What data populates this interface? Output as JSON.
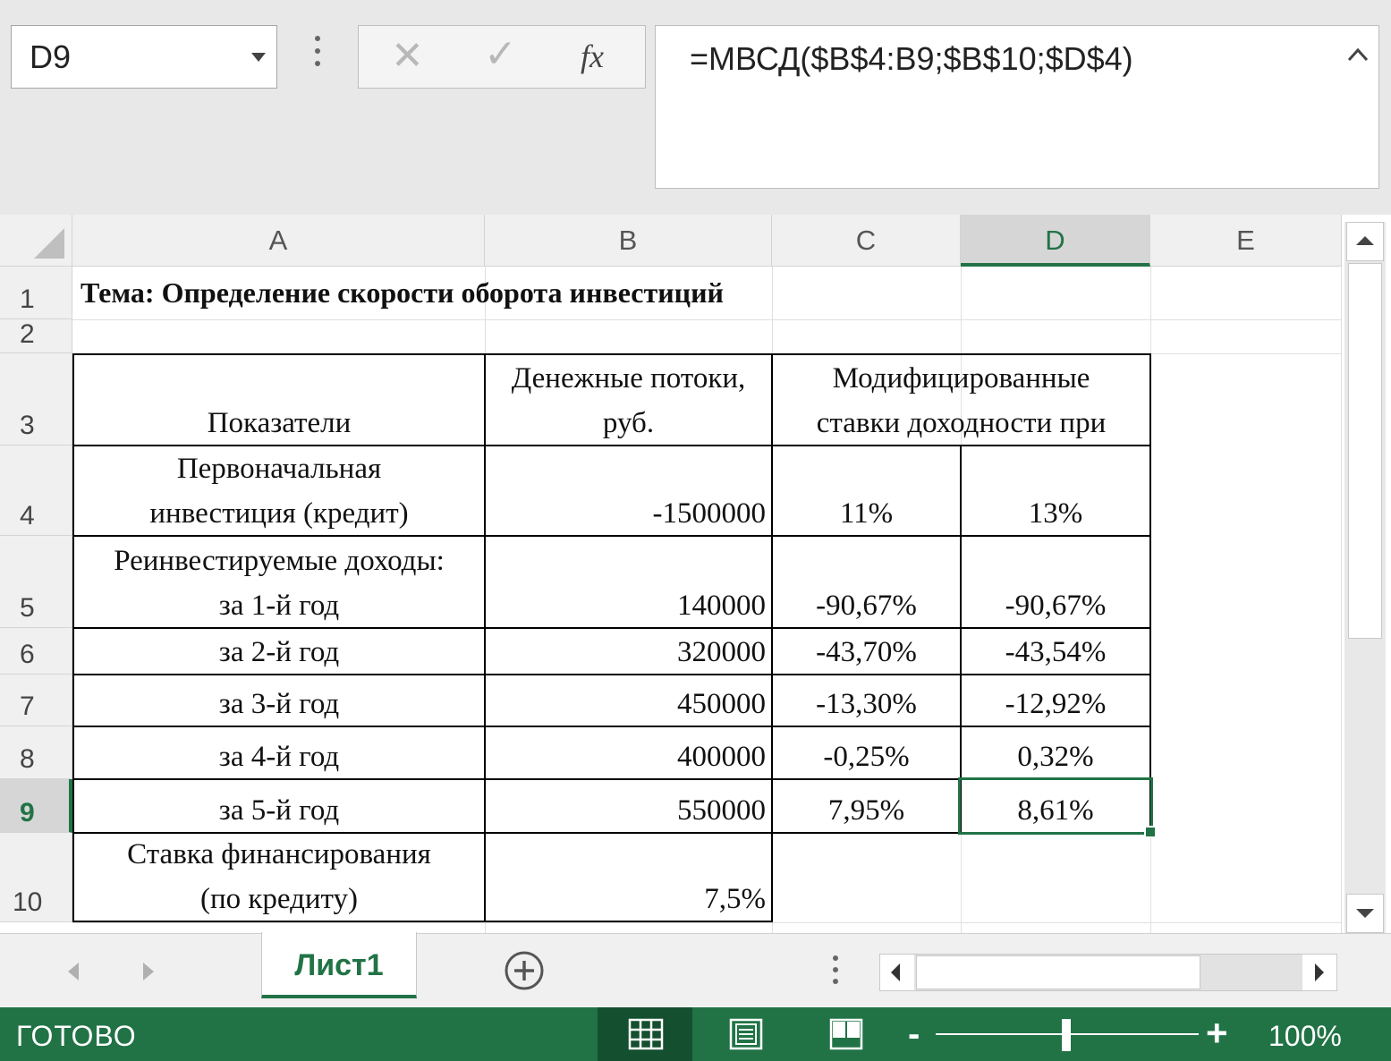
{
  "formula_bar": {
    "name_box": "D9",
    "cancel_glyph": "✕",
    "enter_glyph": "✓",
    "fx_label": "fx",
    "formula": "=МВСД($B$4:B9;$B$10;$D$4)"
  },
  "columns": [
    "A",
    "B",
    "C",
    "D",
    "E"
  ],
  "active_column": "D",
  "rows": [
    "1",
    "2",
    "3",
    "4",
    "5",
    "6",
    "7",
    "8",
    "9",
    "10"
  ],
  "active_row": "9",
  "cells": {
    "A1": "Тема: Определение скорости оборота инвестиций",
    "A3": "Показатели",
    "B3_line1": "Денежные потоки,",
    "B3_line2": "руб.",
    "C3_line1": "Модифицированные",
    "C3_line2": "ставки доходности при",
    "A4_line1": "Первоначальная",
    "A4_line2": "инвестиция (кредит)",
    "B4": "-1500000",
    "C4": "11%",
    "D4": "13%",
    "A5_line1": "Реинвестируемые доходы:",
    "A5_line2": "за 1-й год",
    "B5": "140000",
    "C5": "-90,67%",
    "D5": "-90,67%",
    "A6": "за 2-й год",
    "B6": "320000",
    "C6": "-43,70%",
    "D6": "-43,54%",
    "A7": "за 3-й год",
    "B7": "450000",
    "C7": "-13,30%",
    "D7": "-12,92%",
    "A8": "за 4-й год",
    "B8": "400000",
    "C8": "-0,25%",
    "D8": "0,32%",
    "A9": "за 5-й год",
    "B9": "550000",
    "C9": "7,95%",
    "D9": "8,61%",
    "A10_line1": "Ставка финансирования",
    "A10_line2": "(по кредиту)",
    "B10": "7,5%"
  },
  "sheet_tabs": [
    {
      "label": "Лист1",
      "active": true
    }
  ],
  "status_bar": {
    "status": "ГОТОВО",
    "zoom_minus": "-",
    "zoom_plus": "+",
    "zoom_level": "100%",
    "zoom_percent": 100
  },
  "colors": {
    "accent": "#217346",
    "header_bg": "#f0f0f0",
    "header_active_bg": "#d6d6d6"
  },
  "icons": {
    "name_box_dropdown": "chevron-down-icon",
    "formula_options": "vertical-ellipsis-icon",
    "cancel": "close-icon",
    "enter": "checkmark-icon",
    "function": "fx-icon",
    "collapse": "chevron-up-icon",
    "add_sheet": "plus-circle-icon",
    "view_normal": "grid-icon",
    "view_page_layout": "page-layout-icon",
    "view_page_break": "page-break-icon"
  }
}
